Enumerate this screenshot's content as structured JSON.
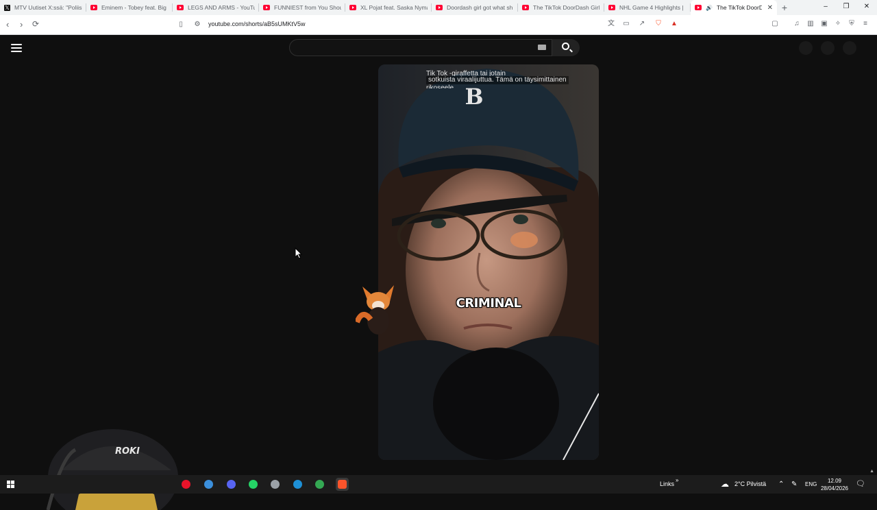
{
  "browser": {
    "tabs": [
      {
        "title": "MTV Uutiset X:ssä: \"Poliisi",
        "favicon": "x-icon",
        "active": false
      },
      {
        "title": "Eminem - Tobey feat. Big",
        "favicon": "youtube-icon",
        "active": false
      },
      {
        "title": "LEGS AND ARMS - YouTu",
        "favicon": "youtube-icon",
        "active": false
      },
      {
        "title": "FUNNIEST from You Shoul",
        "favicon": "youtube-icon",
        "active": false
      },
      {
        "title": "XL Pojat feat. Saska Nyma",
        "favicon": "youtube-icon",
        "active": false
      },
      {
        "title": "Doordash girl got what sh",
        "favicon": "youtube-icon",
        "active": false
      },
      {
        "title": "The TikTok DoorDash Girl",
        "favicon": "youtube-icon",
        "active": false
      },
      {
        "title": "NHL Game 4 Highlights |",
        "favicon": "youtube-icon",
        "active": false
      },
      {
        "title": "The TikTok DoorDa",
        "favicon": "youtube-icon",
        "active": true
      }
    ],
    "new_tab": "+",
    "window_controls": {
      "minimize": "–",
      "maximize": "❐",
      "close": "✕"
    },
    "address_bar": {
      "url": "youtube.com/shorts/aB5sUMKtV5w"
    }
  },
  "youtube": {
    "search": {
      "placeholder": ""
    },
    "short": {
      "subtitle_line1": "Tik Tok -giraffetta tai jotain",
      "subtitle_line2": "sotkuista viraalijuttua.  Tämä on täysimittainen",
      "subtitle_line3": "rikoseele",
      "caption": "CRIMINAL",
      "cap_logo": "B"
    }
  },
  "taskbar": {
    "apps": [
      "opera-icon",
      "photos-icon",
      "discord-icon",
      "whatsapp-icon",
      "vpn-shield-icon",
      "edge-icon",
      "playstore-icon",
      "brave-icon"
    ],
    "links_label": "Links",
    "weather": "2°C  Pilvistä",
    "language": "ENG",
    "time": "12.09",
    "date": "28/04/2026"
  },
  "webcam_overlay": {
    "cap_text": "ROKI"
  }
}
